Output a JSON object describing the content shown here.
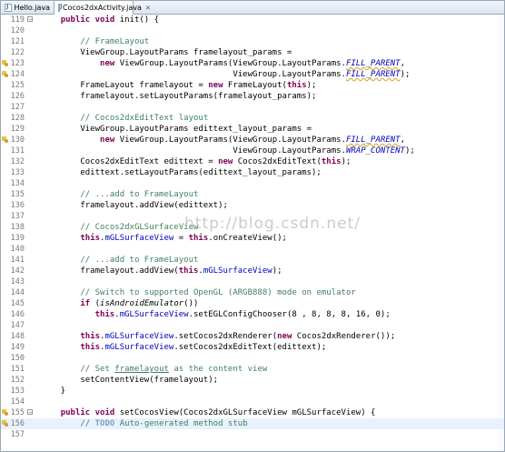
{
  "tabs": [
    {
      "label": "Hello.java"
    },
    {
      "label": "Cocos2dxActivity.java",
      "close": "✕"
    }
  ],
  "watermark": "http://blog.csdn.net/",
  "lines": [
    {
      "n": "119",
      "fold": "⊖",
      "warn": false,
      "html": "    <span class=\"kw\">public void</span> init() {"
    },
    {
      "n": "120",
      "html": ""
    },
    {
      "n": "121",
      "html": "        <span class=\"cm\">// FrameLayout</span>"
    },
    {
      "n": "122",
      "html": "        ViewGroup.LayoutParams framelayout_params ="
    },
    {
      "n": "123",
      "warn": true,
      "html": "            <span class=\"kw\">new</span> ViewGroup.LayoutParams(ViewGroup.LayoutParams.<span class=\"fdit strike wavy\">FILL_PARENT</span>,"
    },
    {
      "n": "124",
      "warn": true,
      "html": "                                       ViewGroup.LayoutParams.<span class=\"fdit strike wavy\">FILL_PARENT</span>);"
    },
    {
      "n": "125",
      "html": "        FrameLayout framelayout = <span class=\"kw\">new</span> FrameLayout(<span class=\"kw\">this</span>);"
    },
    {
      "n": "126",
      "html": "        framelayout.setLayoutParams(framelayout_params);"
    },
    {
      "n": "127",
      "html": ""
    },
    {
      "n": "128",
      "html": "        <span class=\"cm\">// Cocos2dxEditText layout</span>"
    },
    {
      "n": "129",
      "html": "        ViewGroup.LayoutParams edittext_layout_params ="
    },
    {
      "n": "130",
      "warn": true,
      "html": "            <span class=\"kw\">new</span> ViewGroup.LayoutParams(ViewGroup.LayoutParams.<span class=\"fdit strike wavy\">FILL_PARENT</span>,"
    },
    {
      "n": "131",
      "html": "                                       ViewGroup.LayoutParams.<span class=\"fdit\">WRAP_CONTENT</span>);"
    },
    {
      "n": "132",
      "html": "        Cocos2dxEditText edittext = <span class=\"kw\">new</span> Cocos2dxEditText(<span class=\"kw\">this</span>);"
    },
    {
      "n": "133",
      "html": "        edittext.setLayoutParams(edittext_layout_params);"
    },
    {
      "n": "134",
      "html": ""
    },
    {
      "n": "135",
      "html": "        <span class=\"cm\">// ...add to FrameLayout</span>"
    },
    {
      "n": "136",
      "html": "        framelayout.addView(edittext);"
    },
    {
      "n": "137",
      "html": ""
    },
    {
      "n": "138",
      "html": "        <span class=\"cm\">// Cocos2dxGLSurfaceView</span>"
    },
    {
      "n": "139",
      "html": "        <span class=\"kw\">this</span>.<span class=\"fd\">mGLSurfaceView</span> = <span class=\"kw\">this</span>.onCreateView();"
    },
    {
      "n": "140",
      "html": ""
    },
    {
      "n": "141",
      "html": "        <span class=\"cm\">// ...add to FrameLayout</span>"
    },
    {
      "n": "142",
      "html": "        framelayout.addView(<span class=\"kw\">this</span>.<span class=\"fd\">mGLSurfaceView</span>);"
    },
    {
      "n": "143",
      "html": ""
    },
    {
      "n": "144",
      "html": "        <span class=\"cm\">// Switch to supported OpenGL (ARGB888) mode on emulator</span>"
    },
    {
      "n": "145",
      "html": "        <span class=\"kw\">if</span> (<span class=\"it\">isAndroidEmulator</span>())"
    },
    {
      "n": "146",
      "html": "           <span class=\"kw\">this</span>.<span class=\"fd\">mGLSurfaceView</span>.setEGLConfigChooser(8 , 8, 8, 8, 16, 0);"
    },
    {
      "n": "147",
      "html": ""
    },
    {
      "n": "148",
      "html": "        <span class=\"kw\">this</span>.<span class=\"fd\">mGLSurfaceView</span>.setCocos2dxRenderer(<span class=\"kw\">new</span> Cocos2dxRenderer());"
    },
    {
      "n": "149",
      "html": "        <span class=\"kw\">this</span>.<span class=\"fd\">mGLSurfaceView</span>.setCocos2dxEditText(edittext);"
    },
    {
      "n": "150",
      "html": ""
    },
    {
      "n": "151",
      "html": "        <span class=\"cm\">// Set <span style=\"text-decoration:underline\">framelayout</span> as the content view</span>"
    },
    {
      "n": "152",
      "html": "        setContentView(framelayout);"
    },
    {
      "n": "153",
      "html": "    }"
    },
    {
      "n": "154",
      "html": ""
    },
    {
      "n": "155",
      "fold": "⊖",
      "warn": "task",
      "html": "    <span class=\"kw\">public void</span> setCocosView(Cocos2dxGLSurfaceView mGLSurfaceView) {"
    },
    {
      "n": "156",
      "warn": "task",
      "current": true,
      "html": "        <span class=\"cm\">// <span style=\"color:#7f9fbf;font-weight:bold\">TODO</span> Auto-generated method stub</span>"
    },
    {
      "n": "157",
      "html": ""
    }
  ]
}
